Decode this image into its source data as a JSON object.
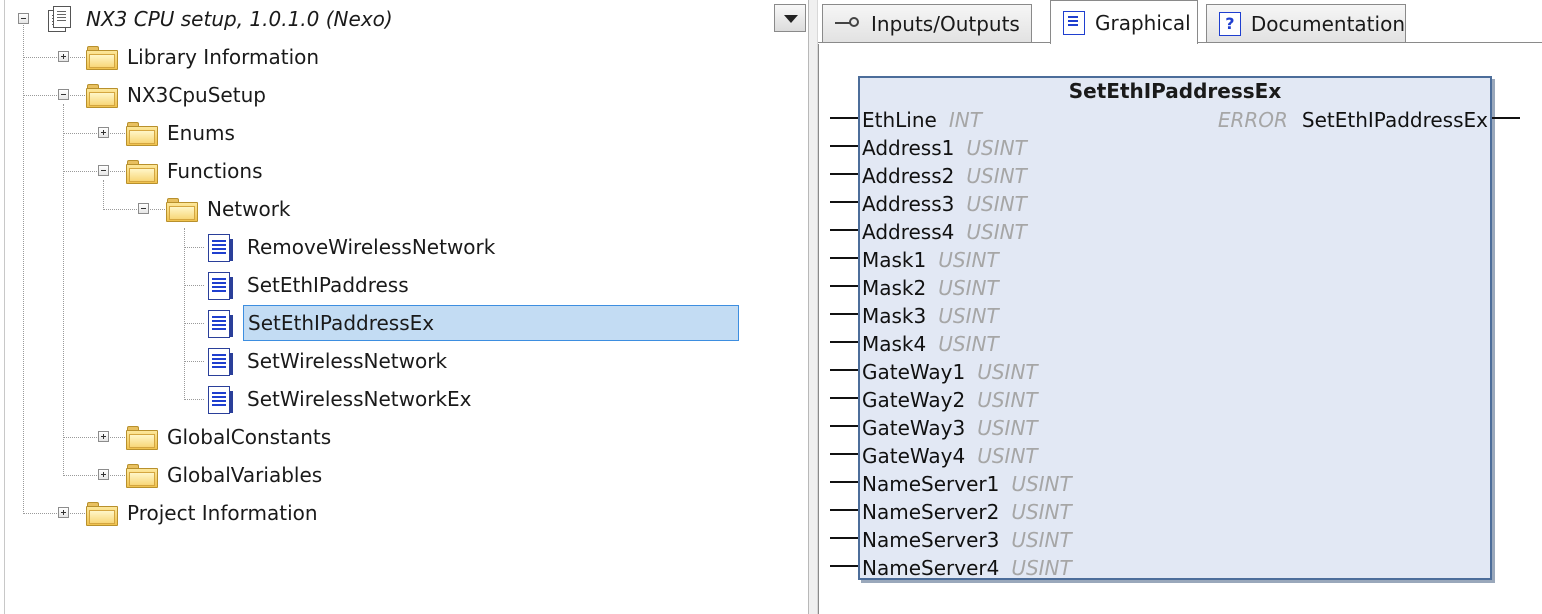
{
  "tree": {
    "root_label": "NX3 CPU setup, 1.0.1.0 (Nexo)",
    "library_information": "Library Information",
    "nx3cpusetup": "NX3CpuSetup",
    "enums": "Enums",
    "functions": "Functions",
    "network": "Network",
    "items": [
      "RemoveWirelessNetwork",
      "SetEthIPaddress",
      "SetEthIPaddressEx",
      "SetWirelessNetwork",
      "SetWirelessNetworkEx"
    ],
    "selected_item": "SetEthIPaddressEx",
    "global_constants": "GlobalConstants",
    "global_variables": "GlobalVariables",
    "project_information": "Project Information"
  },
  "tabs": {
    "inputs_outputs": "Inputs/Outputs",
    "graphical": "Graphical",
    "documentation": "Documentation",
    "active": "Graphical"
  },
  "function_block": {
    "title": "SetEthIPaddressEx",
    "inputs": [
      {
        "name": "EthLine",
        "type": "INT"
      },
      {
        "name": "Address1",
        "type": "USINT"
      },
      {
        "name": "Address2",
        "type": "USINT"
      },
      {
        "name": "Address3",
        "type": "USINT"
      },
      {
        "name": "Address4",
        "type": "USINT"
      },
      {
        "name": "Mask1",
        "type": "USINT"
      },
      {
        "name": "Mask2",
        "type": "USINT"
      },
      {
        "name": "Mask3",
        "type": "USINT"
      },
      {
        "name": "Mask4",
        "type": "USINT"
      },
      {
        "name": "GateWay1",
        "type": "USINT"
      },
      {
        "name": "GateWay2",
        "type": "USINT"
      },
      {
        "name": "GateWay3",
        "type": "USINT"
      },
      {
        "name": "GateWay4",
        "type": "USINT"
      },
      {
        "name": "NameServer1",
        "type": "USINT"
      },
      {
        "name": "NameServer2",
        "type": "USINT"
      },
      {
        "name": "NameServer3",
        "type": "USINT"
      },
      {
        "name": "NameServer4",
        "type": "USINT"
      }
    ],
    "output": {
      "name": "SetEthIPaddressEx",
      "type": "ERROR"
    }
  },
  "colors": {
    "selection_bg": "#c3dcf3",
    "selection_border": "#3d8ee0",
    "block_fill": "#e2e8f4",
    "block_border": "#4c6d9a",
    "type_text": "#a6a6a6"
  }
}
